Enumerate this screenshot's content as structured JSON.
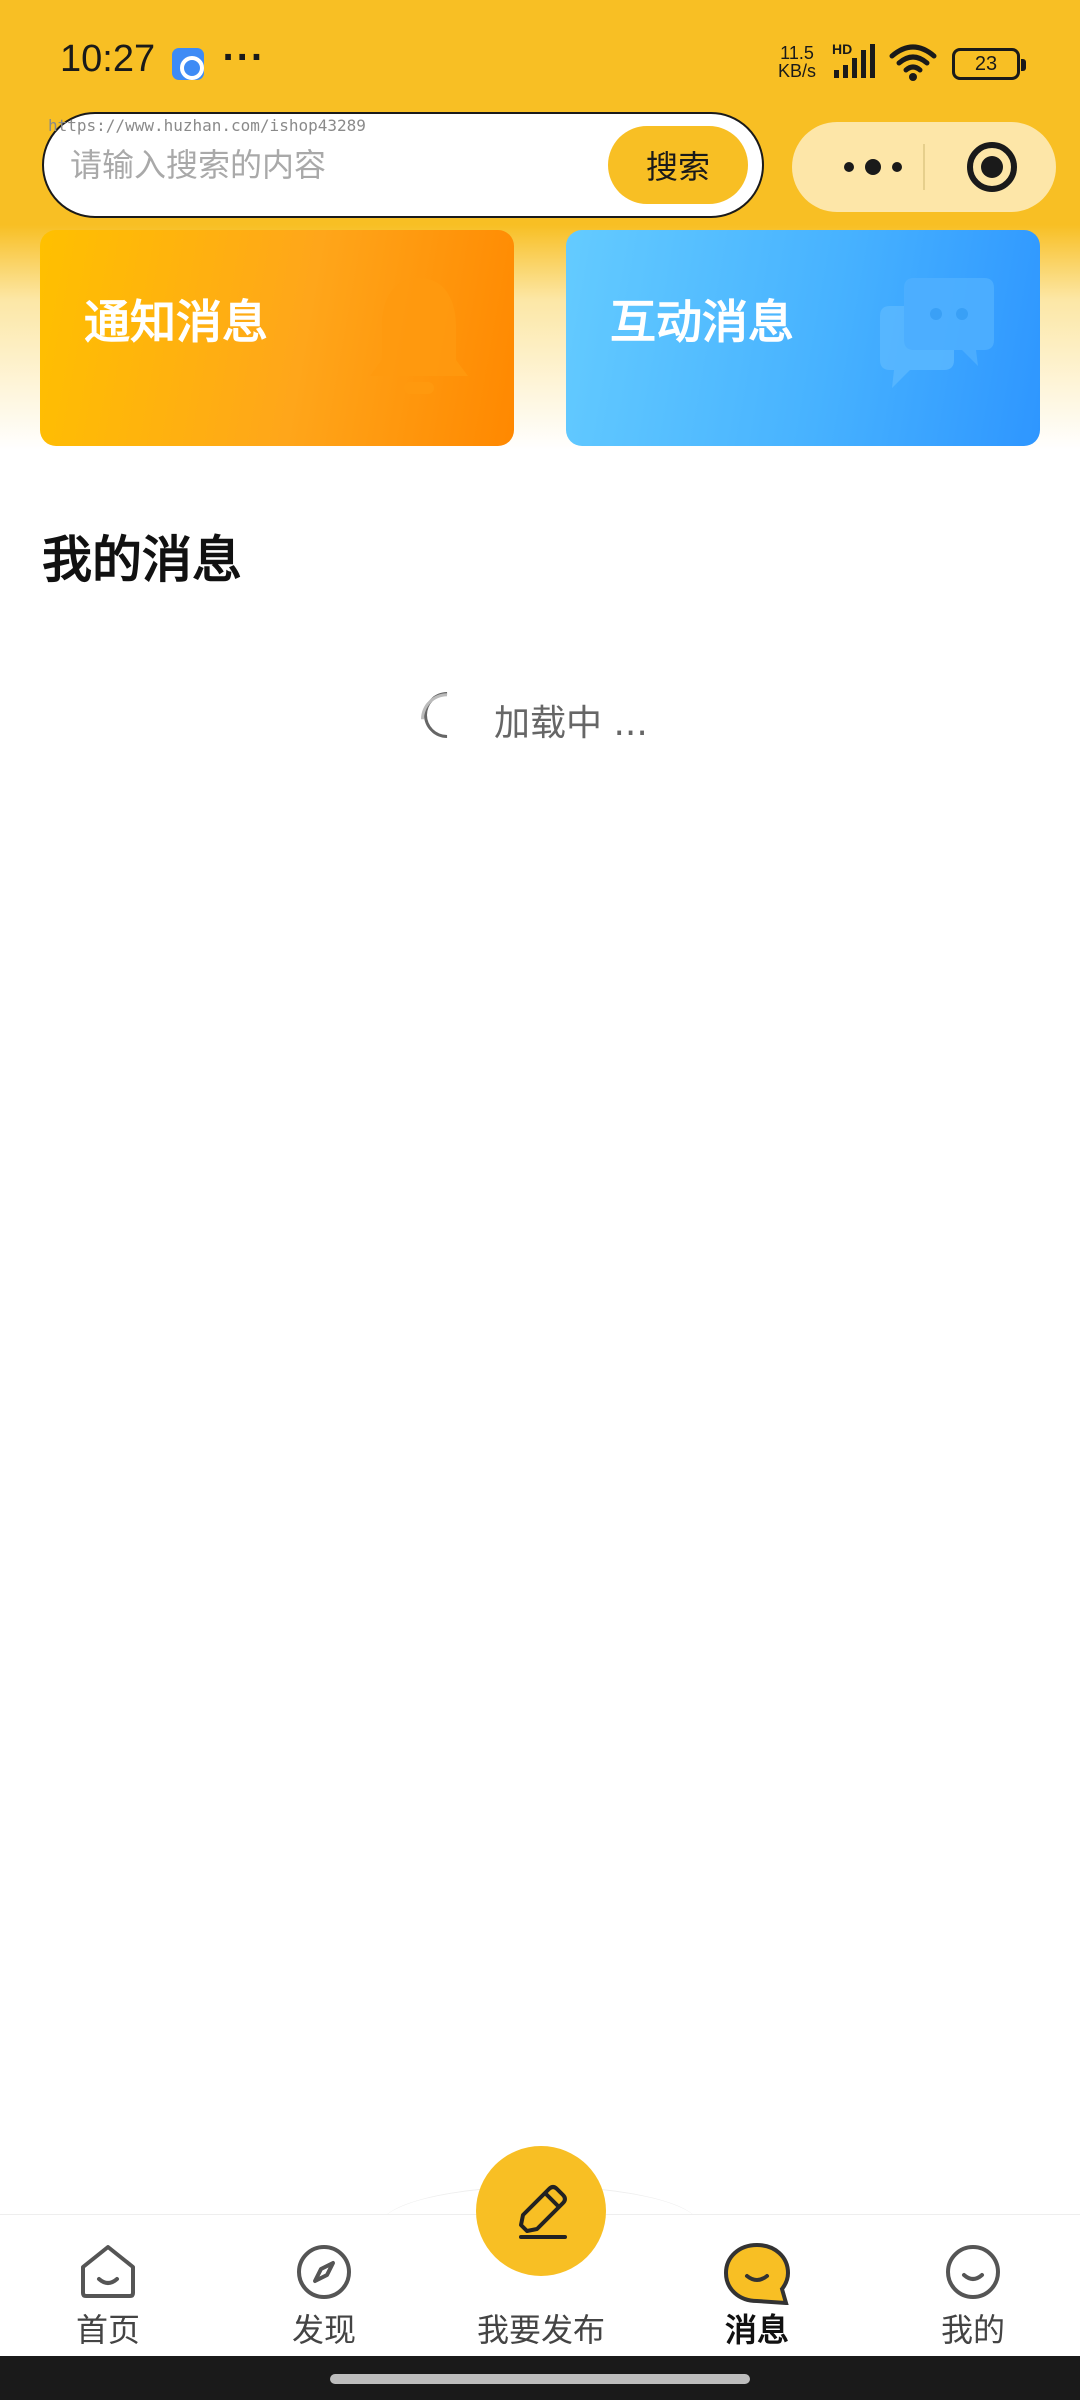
{
  "status_bar": {
    "time": "10:27",
    "net_speed_value": "11.5",
    "net_speed_unit": "KB/s",
    "network_badge": "HD",
    "battery_level": "23"
  },
  "watermark": "https://www.huzhan.com/ishop43289",
  "search": {
    "placeholder": "请输入搜索的内容",
    "button_label": "搜索"
  },
  "cards": [
    {
      "label": "通知消息",
      "icon": "bell-icon",
      "color": "#FFA61A"
    },
    {
      "label": "互动消息",
      "icon": "chat-bubbles-icon",
      "color": "#47B2FF"
    }
  ],
  "section": {
    "title": "我的消息",
    "loading_text": "加载中 ..."
  },
  "tabbar": {
    "items": [
      {
        "label": "首页",
        "icon": "home-icon",
        "active": false
      },
      {
        "label": "发现",
        "icon": "compass-icon",
        "active": false
      },
      {
        "label": "我要发布",
        "icon": "pencil-icon",
        "active": false
      },
      {
        "label": "消息",
        "icon": "message-icon",
        "active": true
      },
      {
        "label": "我的",
        "icon": "profile-icon",
        "active": false
      }
    ]
  },
  "colors": {
    "brand": "#F8BF24",
    "notify_card": "#FFA61A",
    "interact_card": "#47B2FF"
  }
}
